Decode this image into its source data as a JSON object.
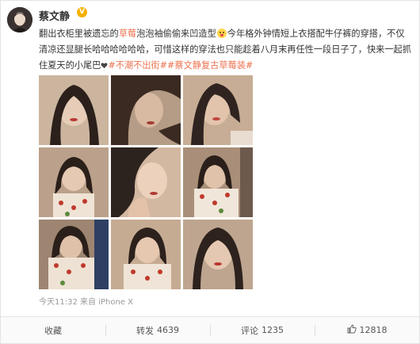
{
  "user": {
    "name": "蔡文静",
    "verified_badge": "V",
    "verified_color": "#f6b100"
  },
  "post": {
    "seg1": "翻出衣柜里被遗忘的",
    "seg2": "草莓",
    "seg3": "泡泡袖偷偷来凹造型",
    "seg4": "今年格外钟情短上衣搭配牛仔裤的穿搭，不仅清凉还显腿长哈哈哈哈哈哈，可惜这样的穿法也只能趁着八月末再任性一段日子了，快来一起抓住夏天的小尾巴",
    "tag1": "#不潮不出街#",
    "tag2": "#蔡文静复古草莓装#",
    "accent_color": "#eb7350"
  },
  "photos": [
    {
      "alt": "photo-1"
    },
    {
      "alt": "photo-2"
    },
    {
      "alt": "photo-3"
    },
    {
      "alt": "photo-4"
    },
    {
      "alt": "photo-5"
    },
    {
      "alt": "photo-6"
    },
    {
      "alt": "photo-7"
    },
    {
      "alt": "photo-8"
    },
    {
      "alt": "photo-9"
    }
  ],
  "meta": {
    "time": "今天11:32",
    "source_prefix": "来自",
    "device": "iPhone X"
  },
  "actions": {
    "favorite": {
      "label": "收藏",
      "icon": "star-icon"
    },
    "repost": {
      "label": "转发",
      "count": "4639",
      "icon": "repost-icon"
    },
    "comment": {
      "label": "评论",
      "count": "1235",
      "icon": "comment-icon"
    },
    "like": {
      "count": "12818",
      "icon": "thumbs-up-icon"
    }
  }
}
